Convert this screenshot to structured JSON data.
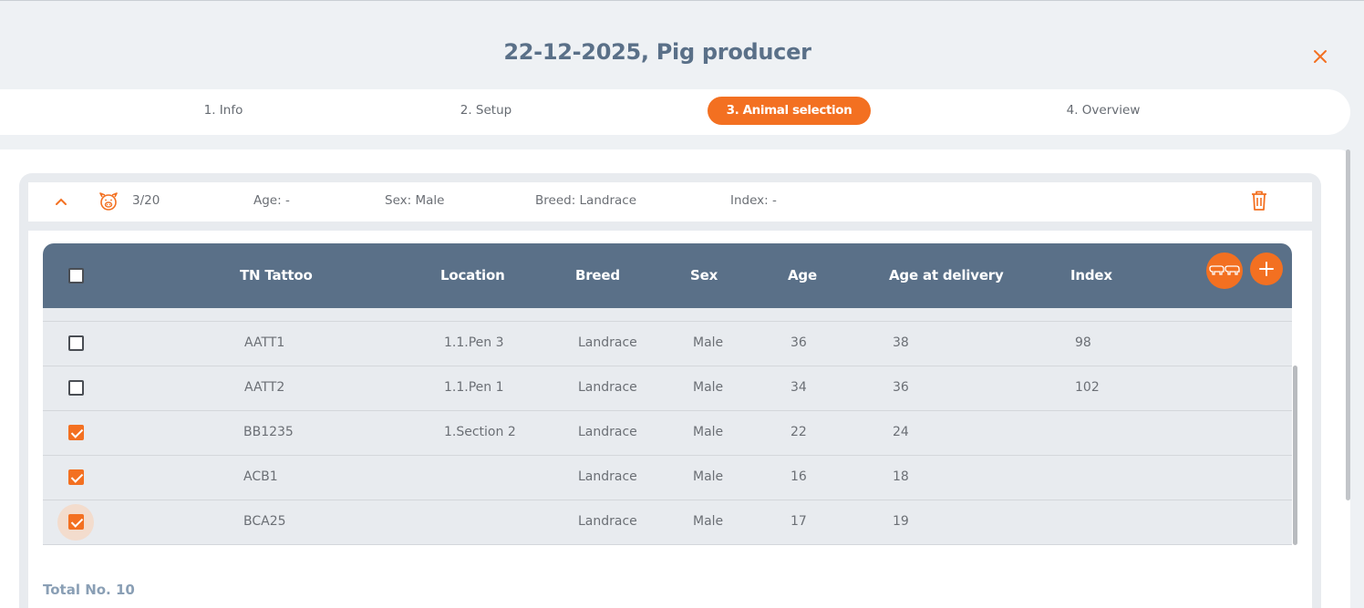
{
  "dialog": {
    "title": "22-12-2025, Pig producer",
    "close_icon": "close-icon",
    "accent_color": "#f37021",
    "header_color": "#5a7088"
  },
  "steps": [
    {
      "label": "1. Info",
      "active": false
    },
    {
      "label": "2. Setup",
      "active": false
    },
    {
      "label": "3. Animal selection",
      "active": true
    },
    {
      "label": "4. Overview",
      "active": false
    }
  ],
  "group": {
    "collapse_icon": "chevron-up-icon",
    "animal_icon": "pig-icon",
    "count": "3/20",
    "age": "Age: -",
    "sex": "Sex: Male",
    "breed": "Breed: Landrace",
    "index": "Index: -",
    "delete_icon": "trash-icon"
  },
  "table": {
    "columns": [
      "TN Tattoo",
      "Location",
      "Breed",
      "Sex",
      "Age",
      "Age at delivery",
      "Index"
    ],
    "actions": {
      "pair_icon": "pigs-icon",
      "add_icon": "plus-icon"
    },
    "rows": [
      {
        "checked": false,
        "tattoo": "AATT1",
        "location": "1.1.Pen 3",
        "breed": "Landrace",
        "sex": "Male",
        "age": "36",
        "age_delivery": "38",
        "index": "98"
      },
      {
        "checked": false,
        "tattoo": "AATT2",
        "location": "1.1.Pen 1",
        "breed": "Landrace",
        "sex": "Male",
        "age": "34",
        "age_delivery": "36",
        "index": "102"
      },
      {
        "checked": true,
        "tattoo": "BB1235",
        "location": "1.Section 2",
        "breed": "Landrace",
        "sex": "Male",
        "age": "22",
        "age_delivery": "24",
        "index": ""
      },
      {
        "checked": true,
        "tattoo": "ACB1",
        "location": "",
        "breed": "Landrace",
        "sex": "Male",
        "age": "16",
        "age_delivery": "18",
        "index": ""
      },
      {
        "checked": true,
        "tattoo": "BCA25",
        "location": "",
        "breed": "Landrace",
        "sex": "Male",
        "age": "17",
        "age_delivery": "19",
        "index": ""
      }
    ]
  },
  "footer": {
    "total": "Total No. 10"
  }
}
